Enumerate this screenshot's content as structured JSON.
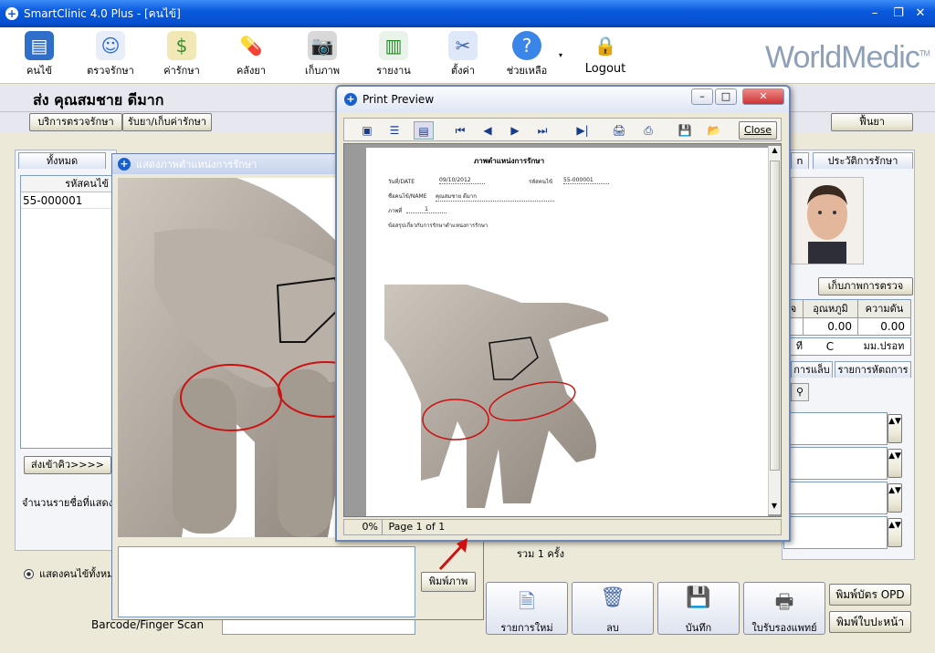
{
  "window": {
    "title": "SmartClinic 4.0 Plus - [คนไข้]"
  },
  "toolbar": [
    {
      "label": "คนไข้",
      "icon": "patient-book-icon"
    },
    {
      "label": "ตรวจรักษา",
      "icon": "doctor-icon"
    },
    {
      "label": "ค่ารักษา",
      "icon": "money-icon"
    },
    {
      "label": "คลังยา",
      "icon": "pill-icon"
    },
    {
      "label": "เก็บภาพ",
      "icon": "camera-icon"
    },
    {
      "label": "รายงาน",
      "icon": "bar-chart-icon"
    },
    {
      "label": "ตั้งค่า",
      "icon": "tools-icon"
    },
    {
      "label": "ช่วยเหลือ",
      "icon": "help-icon"
    },
    {
      "label": "Logout",
      "icon": "lock-icon"
    }
  ],
  "brand": {
    "logo": "WorldMedic",
    "tm": "TM"
  },
  "patient": {
    "name": "ส่ง  คุณสมชาย ดีมาก"
  },
  "subtabs": {
    "exam_service": "บริการตรวจรักษา",
    "medicine": "รับยา/เก็บค่ารักษา",
    "refresh": "ฟื้นยา"
  },
  "left": {
    "tab_all": "ทั้งหมด",
    "col_header": "รหัสคนไข้",
    "rows": [
      "55-000001"
    ],
    "queue_button": "ส่งเข้าคิว>>>>",
    "count_label": "จำนวนรายชื่อที่แสดง",
    "radio_label": "แสดงคนไข้ทั้งหม",
    "barcode_label": "Barcode/Finger Scan"
  },
  "treat_dialog": {
    "title": "แสดงภาพตำแหน่งการรักษา",
    "print_button": "พิมพ์ภาพ"
  },
  "right": {
    "tab_history": "ประวัติการรักษา",
    "tab_n": "n",
    "photo_button": "เก็บภาพการตรวจ",
    "vitals_headers": [
      "จ",
      "อุณหภูมิ",
      "ความดัน"
    ],
    "vitals_values": [
      "",
      "0.00",
      "0.00"
    ],
    "row2": [
      "ที",
      "C",
      "มม.ปรอท"
    ],
    "tab_lab": "การแล็บ",
    "tab_proc": "รายการหัตถการ",
    "total": "รวม 1 ครั้ง"
  },
  "bottom_buttons": [
    {
      "label": "รายการใหม่",
      "icon": "new-document-icon"
    },
    {
      "label": "ลบ",
      "icon": "trash-icon"
    },
    {
      "label": "บันทึก",
      "icon": "save-icon"
    },
    {
      "label": "ใบรับรองแพทย์",
      "icon": "printer-icon"
    }
  ],
  "print_opd": "พิมพ์บัตร OPD",
  "print_front": "พิมพ์ใบปะหน้า",
  "preview": {
    "title": "Print Preview",
    "close": "Close",
    "status_pct": "0%",
    "status_page": "Page 1 of 1",
    "doc": {
      "heading": "ภาพตำแหน่งการรักษา",
      "date_label": "วันที่/DATE",
      "date_value": "09/10/2012",
      "id_label": "รหัสคนไข้",
      "id_value": "55-000001",
      "name_label": "ชื่อคนไข้/NAME",
      "name_value": "คุณสมชาย ดีมาก",
      "page_label": "ภาพที่",
      "page_value": "1",
      "note": "ข้อสรุปเกี่ยวกับการรักษาตำแหน่งการรักษา"
    }
  }
}
